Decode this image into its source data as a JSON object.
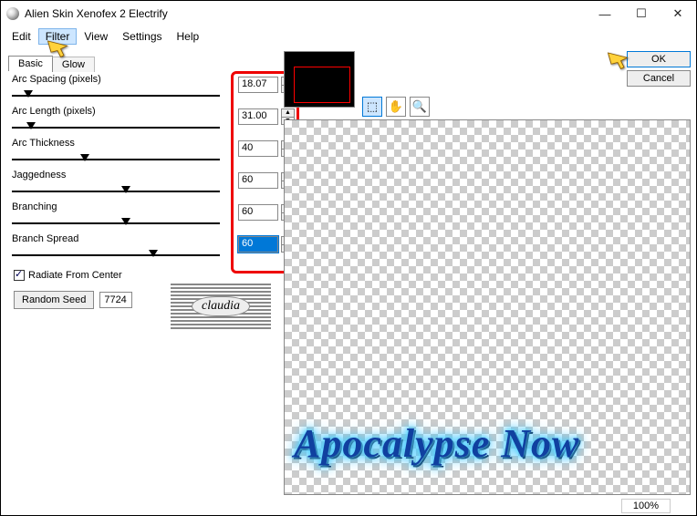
{
  "window": {
    "title": "Alien Skin Xenofex 2 Electrify"
  },
  "menu": {
    "items": [
      "Edit",
      "Filter",
      "View",
      "Settings",
      "Help"
    ],
    "highlighted": 1
  },
  "tabs": {
    "active": "Basic",
    "inactive": "Glow"
  },
  "sliders": [
    {
      "label": "Arc Spacing (pixels)",
      "value": "18.07",
      "thumb_pct": 8
    },
    {
      "label": "Arc Length (pixels)",
      "value": "31.00",
      "thumb_pct": 9
    },
    {
      "label": "Arc Thickness",
      "value": "40",
      "thumb_pct": 35
    },
    {
      "label": "Jaggedness",
      "value": "60",
      "thumb_pct": 55
    },
    {
      "label": "Branching",
      "value": "60",
      "thumb_pct": 55
    },
    {
      "label": "Branch Spread",
      "value": "60",
      "thumb_pct": 68,
      "selected": true
    }
  ],
  "checkbox": {
    "label": "Radiate From Center",
    "checked": true
  },
  "random_seed": {
    "button": "Random Seed",
    "value": "7724"
  },
  "logo_text": "claudia",
  "tools": [
    {
      "name": "hand-select-icon",
      "glyph": "⬚",
      "selected": true
    },
    {
      "name": "pan-icon",
      "glyph": "✋",
      "selected": false
    },
    {
      "name": "zoom-icon",
      "glyph": "🔍",
      "selected": false
    }
  ],
  "preview_text": "Apocalypse Now",
  "zoom_label": "100%",
  "buttons": {
    "ok": "OK",
    "cancel": "Cancel"
  }
}
